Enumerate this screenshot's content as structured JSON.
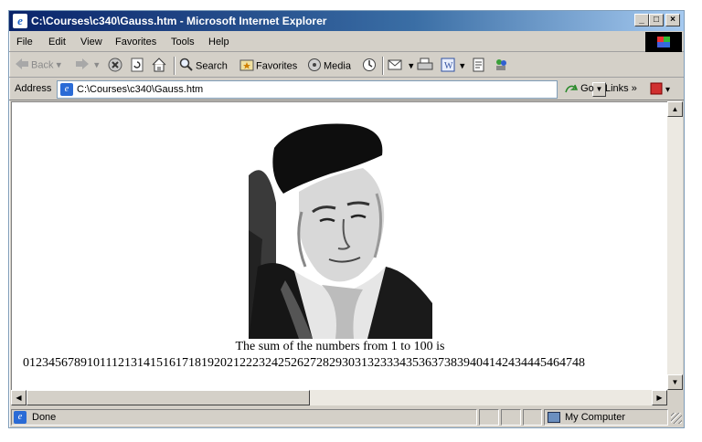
{
  "window": {
    "title": "C:\\Courses\\c340\\Gauss.htm - Microsoft Internet Explorer",
    "controls": {
      "minimize": "_",
      "maximize": "□",
      "close": "×"
    }
  },
  "menu": {
    "items": [
      "File",
      "Edit",
      "View",
      "Favorites",
      "Tools",
      "Help"
    ]
  },
  "toolbar": {
    "back": "Back",
    "search": "Search",
    "favorites": "Favorites",
    "media": "Media"
  },
  "address": {
    "label": "Address",
    "url": "C:\\Courses\\c340\\Gauss.htm",
    "go": "Go",
    "links": "Links"
  },
  "content": {
    "caption": "The sum of the numbers from 1 to 100 is",
    "numbers": "0123456789101112131415161718192021222324252627282930313233343536373839404142434445464748"
  },
  "status": {
    "text": "Done",
    "zone": "My Computer"
  },
  "icons": [
    "ie-icon",
    "back-icon",
    "forward-icon",
    "stop-icon",
    "refresh-icon",
    "home-icon",
    "search-icon",
    "favorites-icon",
    "media-icon",
    "history-icon",
    "mail-icon",
    "print-icon",
    "edit-icon",
    "discuss-icon",
    "messenger-icon",
    "go-icon",
    "windows-logo-icon",
    "computer-icon"
  ]
}
